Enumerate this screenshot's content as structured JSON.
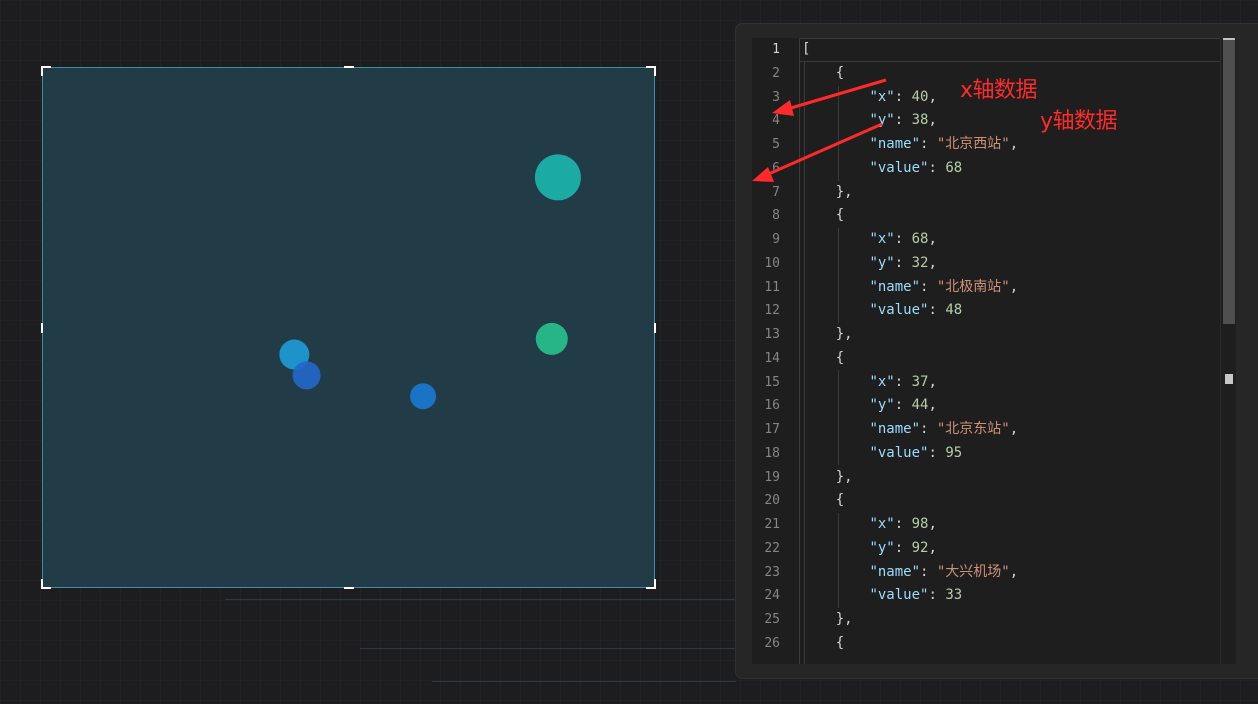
{
  "colors": {
    "background": "#1d1d1f",
    "widget_bg": "#213c46",
    "widget_border": "#3e8ea6",
    "annotation": "#ff2a2a"
  },
  "chart_data": {
    "type": "scatter",
    "title": "",
    "xlabel": "",
    "ylabel": "",
    "grid": false,
    "legend": "none",
    "xlim": [
      0,
      100
    ],
    "ylim": [
      0,
      100
    ],
    "series": [
      {
        "points": [
          {
            "x": 84,
            "y": 79,
            "size": 46,
            "color": "#1cb5ad"
          },
          {
            "x": 83,
            "y": 48,
            "size": 32,
            "color": "#27c08c"
          },
          {
            "x": 41,
            "y": 45,
            "size": 30,
            "color": "#1e9bd6"
          },
          {
            "x": 43,
            "y": 41,
            "size": 28,
            "color": "#2368c8"
          },
          {
            "x": 62,
            "y": 37,
            "size": 26,
            "color": "#1b78d0"
          }
        ]
      }
    ]
  },
  "editor": {
    "cursor_line": "1",
    "lines": [
      {
        "no": "1",
        "tokens": [
          {
            "t": "punc",
            "v": "["
          }
        ]
      },
      {
        "no": "2",
        "tokens": [
          {
            "t": "punc",
            "v": "    {"
          }
        ]
      },
      {
        "no": "3",
        "tokens": [
          {
            "t": "punc",
            "v": "        "
          },
          {
            "t": "key",
            "v": "\"x\""
          },
          {
            "t": "punc",
            "v": ": "
          },
          {
            "t": "num",
            "v": "40"
          },
          {
            "t": "punc",
            "v": ","
          }
        ]
      },
      {
        "no": "4",
        "tokens": [
          {
            "t": "punc",
            "v": "        "
          },
          {
            "t": "key",
            "v": "\"y\""
          },
          {
            "t": "punc",
            "v": ": "
          },
          {
            "t": "num",
            "v": "38"
          },
          {
            "t": "punc",
            "v": ","
          }
        ]
      },
      {
        "no": "5",
        "tokens": [
          {
            "t": "punc",
            "v": "        "
          },
          {
            "t": "key",
            "v": "\"name\""
          },
          {
            "t": "punc",
            "v": ": "
          },
          {
            "t": "str",
            "v": "\"北京西站\""
          },
          {
            "t": "punc",
            "v": ","
          }
        ]
      },
      {
        "no": "6",
        "tokens": [
          {
            "t": "punc",
            "v": "        "
          },
          {
            "t": "key",
            "v": "\"value\""
          },
          {
            "t": "punc",
            "v": ": "
          },
          {
            "t": "num",
            "v": "68"
          }
        ]
      },
      {
        "no": "7",
        "tokens": [
          {
            "t": "punc",
            "v": "    },"
          }
        ]
      },
      {
        "no": "8",
        "tokens": [
          {
            "t": "punc",
            "v": "    {"
          }
        ]
      },
      {
        "no": "9",
        "tokens": [
          {
            "t": "punc",
            "v": "        "
          },
          {
            "t": "key",
            "v": "\"x\""
          },
          {
            "t": "punc",
            "v": ": "
          },
          {
            "t": "num",
            "v": "68"
          },
          {
            "t": "punc",
            "v": ","
          }
        ]
      },
      {
        "no": "10",
        "tokens": [
          {
            "t": "punc",
            "v": "        "
          },
          {
            "t": "key",
            "v": "\"y\""
          },
          {
            "t": "punc",
            "v": ": "
          },
          {
            "t": "num",
            "v": "32"
          },
          {
            "t": "punc",
            "v": ","
          }
        ]
      },
      {
        "no": "11",
        "tokens": [
          {
            "t": "punc",
            "v": "        "
          },
          {
            "t": "key",
            "v": "\"name\""
          },
          {
            "t": "punc",
            "v": ": "
          },
          {
            "t": "str",
            "v": "\"北极南站\""
          },
          {
            "t": "punc",
            "v": ","
          }
        ]
      },
      {
        "no": "12",
        "tokens": [
          {
            "t": "punc",
            "v": "        "
          },
          {
            "t": "key",
            "v": "\"value\""
          },
          {
            "t": "punc",
            "v": ": "
          },
          {
            "t": "num",
            "v": "48"
          }
        ]
      },
      {
        "no": "13",
        "tokens": [
          {
            "t": "punc",
            "v": "    },"
          }
        ]
      },
      {
        "no": "14",
        "tokens": [
          {
            "t": "punc",
            "v": "    {"
          }
        ]
      },
      {
        "no": "15",
        "tokens": [
          {
            "t": "punc",
            "v": "        "
          },
          {
            "t": "key",
            "v": "\"x\""
          },
          {
            "t": "punc",
            "v": ": "
          },
          {
            "t": "num",
            "v": "37"
          },
          {
            "t": "punc",
            "v": ","
          }
        ]
      },
      {
        "no": "16",
        "tokens": [
          {
            "t": "punc",
            "v": "        "
          },
          {
            "t": "key",
            "v": "\"y\""
          },
          {
            "t": "punc",
            "v": ": "
          },
          {
            "t": "num",
            "v": "44"
          },
          {
            "t": "punc",
            "v": ","
          }
        ]
      },
      {
        "no": "17",
        "tokens": [
          {
            "t": "punc",
            "v": "        "
          },
          {
            "t": "key",
            "v": "\"name\""
          },
          {
            "t": "punc",
            "v": ": "
          },
          {
            "t": "str",
            "v": "\"北京东站\""
          },
          {
            "t": "punc",
            "v": ","
          }
        ]
      },
      {
        "no": "18",
        "tokens": [
          {
            "t": "punc",
            "v": "        "
          },
          {
            "t": "key",
            "v": "\"value\""
          },
          {
            "t": "punc",
            "v": ": "
          },
          {
            "t": "num",
            "v": "95"
          }
        ]
      },
      {
        "no": "19",
        "tokens": [
          {
            "t": "punc",
            "v": "    },"
          }
        ]
      },
      {
        "no": "20",
        "tokens": [
          {
            "t": "punc",
            "v": "    {"
          }
        ]
      },
      {
        "no": "21",
        "tokens": [
          {
            "t": "punc",
            "v": "        "
          },
          {
            "t": "key",
            "v": "\"x\""
          },
          {
            "t": "punc",
            "v": ": "
          },
          {
            "t": "num",
            "v": "98"
          },
          {
            "t": "punc",
            "v": ","
          }
        ]
      },
      {
        "no": "22",
        "tokens": [
          {
            "t": "punc",
            "v": "        "
          },
          {
            "t": "key",
            "v": "\"y\""
          },
          {
            "t": "punc",
            "v": ": "
          },
          {
            "t": "num",
            "v": "92"
          },
          {
            "t": "punc",
            "v": ","
          }
        ]
      },
      {
        "no": "23",
        "tokens": [
          {
            "t": "punc",
            "v": "        "
          },
          {
            "t": "key",
            "v": "\"name\""
          },
          {
            "t": "punc",
            "v": ": "
          },
          {
            "t": "str",
            "v": "\"大兴机场\""
          },
          {
            "t": "punc",
            "v": ","
          }
        ]
      },
      {
        "no": "24",
        "tokens": [
          {
            "t": "punc",
            "v": "        "
          },
          {
            "t": "key",
            "v": "\"value\""
          },
          {
            "t": "punc",
            "v": ": "
          },
          {
            "t": "num",
            "v": "33"
          }
        ]
      },
      {
        "no": "25",
        "tokens": [
          {
            "t": "punc",
            "v": "    },"
          }
        ]
      },
      {
        "no": "26",
        "tokens": [
          {
            "t": "punc",
            "v": "    {"
          }
        ]
      }
    ]
  },
  "annotations": {
    "x_label": "x轴数据",
    "y_label": "y轴数据"
  }
}
